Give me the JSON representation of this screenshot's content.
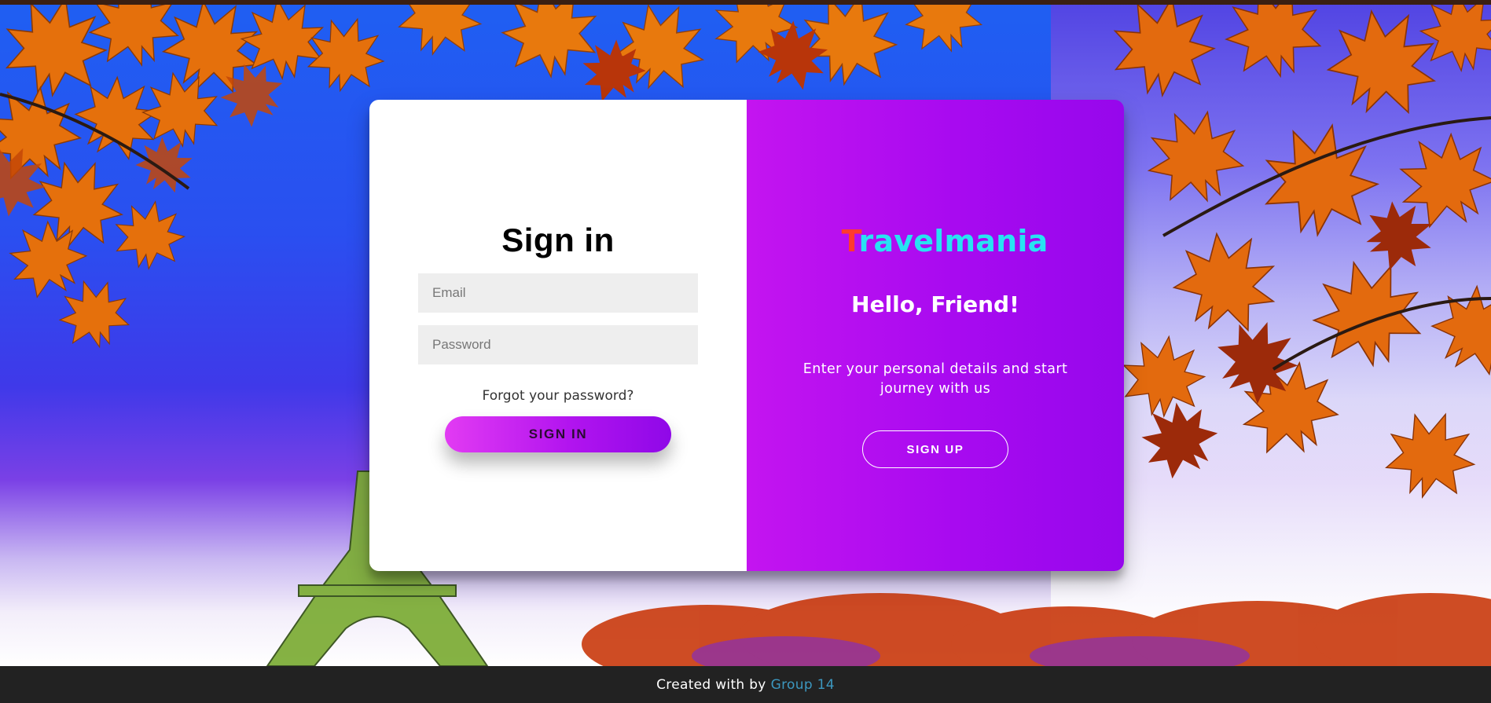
{
  "signin": {
    "title": "Sign in",
    "email_placeholder": "Email",
    "password_placeholder": "Password",
    "forgot_label": "Forgot your password?",
    "button_label": "SIGN IN"
  },
  "overlay": {
    "brand_first": "T",
    "brand_rest": "ravelmania",
    "greeting": "Hello, Friend!",
    "description": "Enter your personal details and start journey with us",
    "button_label": "SIGN UP"
  },
  "footer": {
    "text": "Created with by",
    "link_label": "Group 14"
  },
  "colors": {
    "brand_first": "#ff3a2e",
    "brand_rest": "#27e3f2",
    "accent_gradient_start": "#e23bf3",
    "accent_gradient_end": "#8f08e8",
    "footer_link": "#3c97bf"
  },
  "background": {
    "icon": "autumn-leaves-eiffel-tower-photo"
  }
}
